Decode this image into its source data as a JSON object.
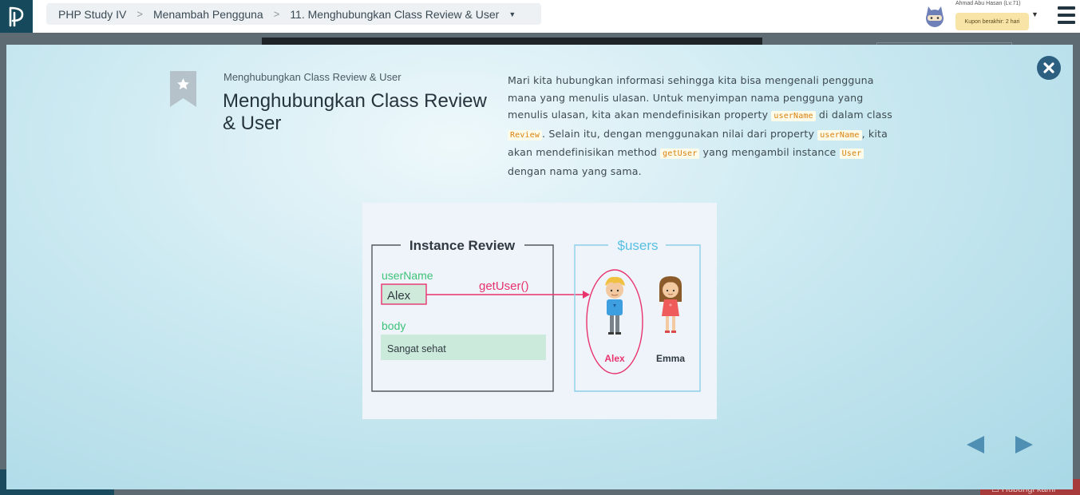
{
  "header": {
    "breadcrumb": [
      "PHP Study IV",
      "Menambah Pengguna",
      "11. Menghubungkan Class Review & User"
    ],
    "user_name": "Ahmad Abu Hasan (Lv.71)",
    "coupon": "Kupon berakhir: 2 hari",
    "icons": {
      "logo": "progate-logo-icon",
      "caret": "chevron-down-icon",
      "menu": "hamburger-menu-icon",
      "avatar": "ninja-cat-avatar"
    }
  },
  "background": {
    "bottom_right_label": "☐ Hubungi kami"
  },
  "slide": {
    "subtitle": "Menghubungkan Class Review & User",
    "title": "Menghubungkan Class Review & User",
    "description": [
      {
        "t": "text",
        "v": "Mari kita hubungkan informasi sehingga kita bisa mengenali pengguna mana yang menulis ulasan. Untuk menyimpan nama pengguna yang menulis ulasan, kita akan mendefinisikan property "
      },
      {
        "t": "code",
        "v": "userName"
      },
      {
        "t": "text",
        "v": " di dalam class "
      },
      {
        "t": "code",
        "v": "Review"
      },
      {
        "t": "text",
        "v": ". Selain itu, dengan menggunakan nilai dari property "
      },
      {
        "t": "code",
        "v": "userName"
      },
      {
        "t": "text",
        "v": ", kita akan mendefinisikan method "
      },
      {
        "t": "code",
        "v": "getUser"
      },
      {
        "t": "text",
        "v": " yang mengambil instance "
      },
      {
        "t": "code",
        "v": "User"
      },
      {
        "t": "text",
        "v": " dengan nama yang sama."
      }
    ],
    "diagram": {
      "left_box_title": "Instance Review",
      "field1_label": "userName",
      "field1_value": "Alex",
      "arrow_label": "getUser()",
      "field2_label": "body",
      "field2_value": "Sangat sehat",
      "right_box_title": "$users",
      "user1": "Alex",
      "user2": "Emma"
    },
    "icons": {
      "close": "close-icon",
      "bookmark": "bookmark-star-icon",
      "prev": "arrow-left-icon",
      "next": "arrow-right-icon"
    },
    "colors": {
      "accent_green": "#3fc27a",
      "accent_pink": "#e8336e",
      "accent_blue": "#58bfe3",
      "nav_arrow": "#4e8fb3"
    }
  }
}
